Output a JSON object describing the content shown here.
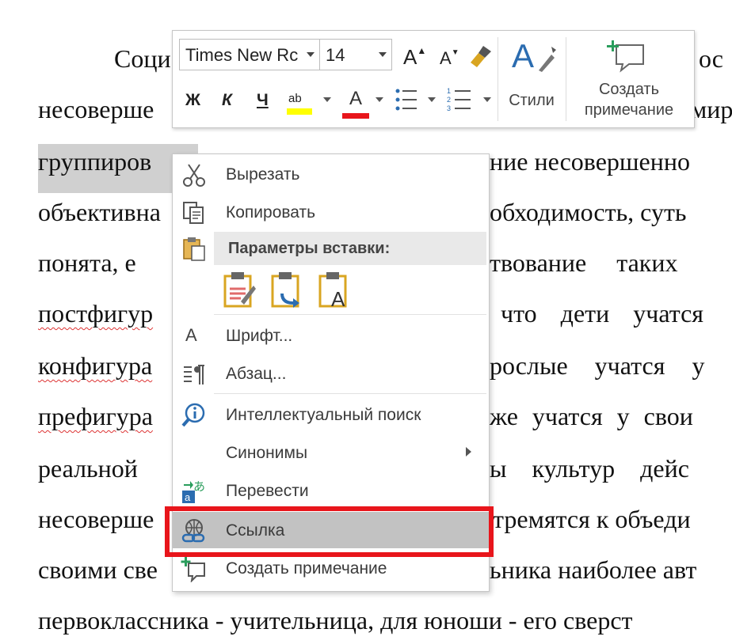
{
  "document": {
    "lines": [
      {
        "text": "Соци",
        "tail": "ос"
      },
      {
        "text": "несоверше",
        "tail": "мир"
      },
      {
        "text": "группиров",
        "tail": "ние несовершенно"
      },
      {
        "text": "объективна",
        "tail": "обходимость, суть"
      },
      {
        "text": "понята, е",
        "tail": "твование таких"
      },
      {
        "text": "постфигур",
        "tail": "что дети учатся"
      },
      {
        "text": "конфигура",
        "tail": "рослые учатся у"
      },
      {
        "text": "префигура",
        "tail": "же учатся у свои"
      },
      {
        "text": "реальной",
        "tail": "ы культур дейс"
      },
      {
        "text": "несоверше",
        "tail": "тремятся к объеди"
      },
      {
        "text": "своими све",
        "tail": "ьника наиболее авт"
      },
      {
        "text": "первоклассника - учительница, для юноши - его сверст",
        "tail": ""
      }
    ]
  },
  "toolbar": {
    "font_name": "Times New Rc",
    "font_size": "14",
    "grow_font": "A",
    "shrink_font": "A",
    "bold": "Ж",
    "italic": "К",
    "underline": "Ч",
    "highlight": "ab",
    "font_color": "A",
    "styles_label": "Стили",
    "comment_label_1": "Создать",
    "comment_label_2": "примечание"
  },
  "menu": {
    "cut": "Вырезать",
    "copy": "Копировать",
    "paste_options": "Параметры вставки:",
    "font": "Шрифт...",
    "paragraph": "Абзац...",
    "smart_lookup": "Интеллектуальный поиск",
    "synonyms": "Синонимы",
    "translate": "Перевести",
    "link": "Ссылка",
    "new_comment": "Создать примечание",
    "font_icon_letter": "A"
  },
  "colors": {
    "highlight_yellow": "#ffff00",
    "font_red": "#e8151b",
    "accent_blue": "#2b6cb0",
    "selection_box": "#e8151b"
  }
}
